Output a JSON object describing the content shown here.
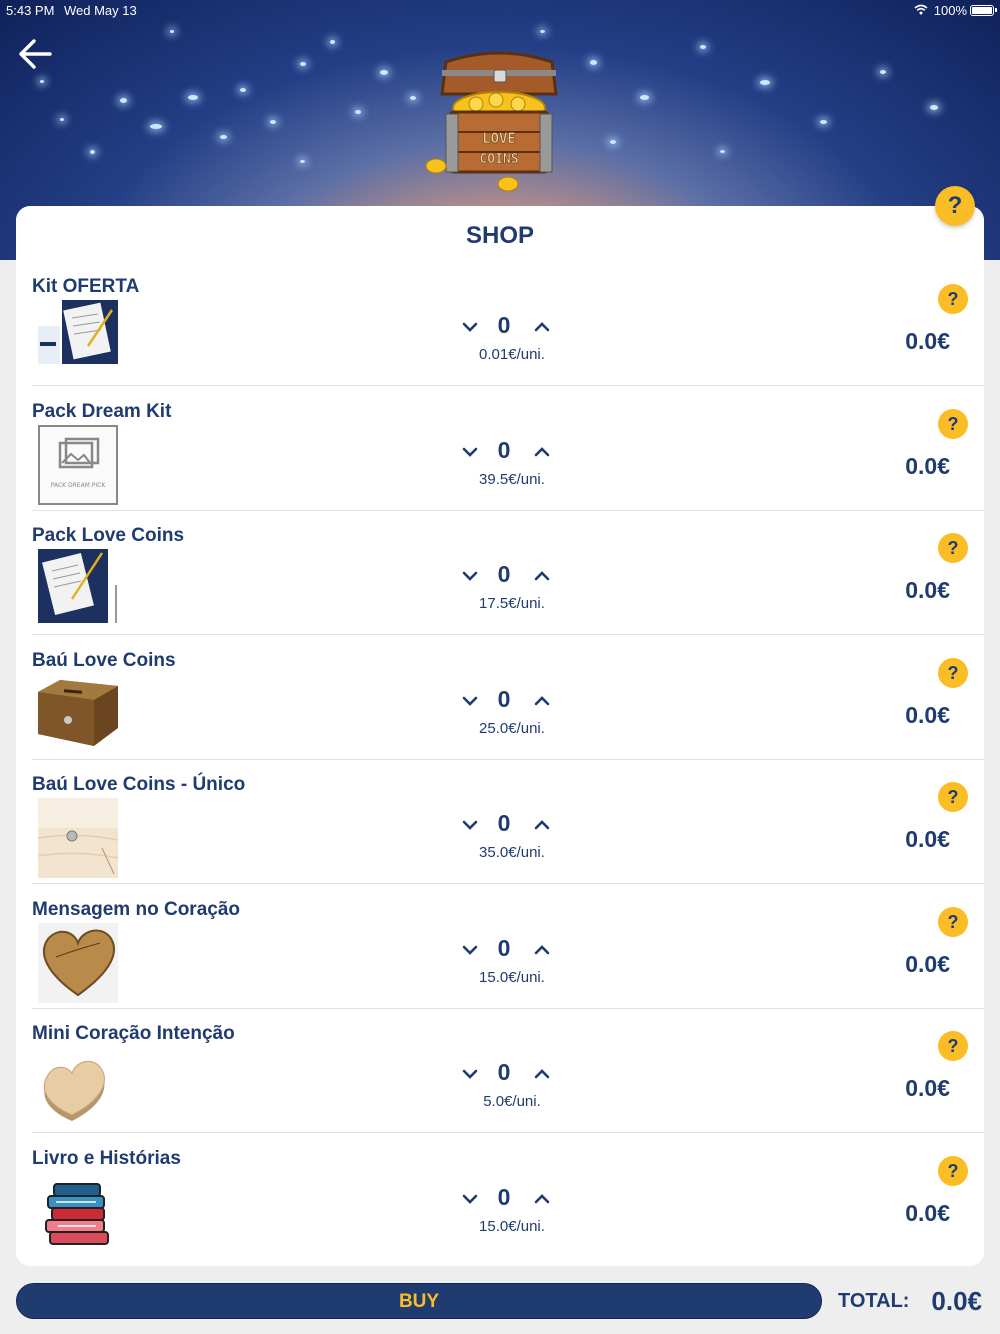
{
  "status_bar": {
    "time": "5:43 PM",
    "date": "Wed May 13",
    "battery": "100%"
  },
  "header": {
    "logo_text_1": "LOVE",
    "logo_text_2": "COINS"
  },
  "shop": {
    "title": "SHOP",
    "help_label": "?",
    "products": [
      {
        "name": "Kit OFERTA",
        "qty": "0",
        "unit_price": "0.01€/uni.",
        "total": "0.0€",
        "info": "?",
        "thumb": "letter-pen-icon"
      },
      {
        "name": "Pack Dream Kit",
        "qty": "0",
        "unit_price": "39.5€/uni.",
        "total": "0.0€",
        "info": "?",
        "thumb": "image-placeholder-icon",
        "thumb_caption": "PACK DREAM PICK"
      },
      {
        "name": "Pack Love Coins",
        "qty": "0",
        "unit_price": "17.5€/uni.",
        "total": "0.0€",
        "info": "?",
        "thumb": "letter-pen-icon"
      },
      {
        "name": "Baú Love Coins",
        "qty": "0",
        "unit_price": "25.0€/uni.",
        "total": "0.0€",
        "info": "?",
        "thumb": "wooden-box-icon"
      },
      {
        "name": "Baú Love Coins - Único",
        "qty": "0",
        "unit_price": "35.0€/uni.",
        "total": "0.0€",
        "info": "?",
        "thumb": "wood-plank-icon"
      },
      {
        "name": "Mensagem no Coração",
        "qty": "0",
        "unit_price": "15.0€/uni.",
        "total": "0.0€",
        "info": "?",
        "thumb": "wooden-heart-icon"
      },
      {
        "name": "Mini Coração Intenção",
        "qty": "0",
        "unit_price": "5.0€/uni.",
        "total": "0.0€",
        "info": "?",
        "thumb": "mini-heart-icon"
      },
      {
        "name": "Livro e Histórias",
        "qty": "0",
        "unit_price": "15.0€/uni.",
        "total": "0.0€",
        "info": "?",
        "thumb": "books-stack-icon"
      }
    ]
  },
  "footer": {
    "buy_label": "BUY",
    "total_label": "TOTAL:",
    "total_value": "0.0€"
  },
  "colors": {
    "primary": "#1f3b70",
    "accent": "#fbbd26",
    "card": "#ffffff",
    "background": "#eeeeee"
  }
}
